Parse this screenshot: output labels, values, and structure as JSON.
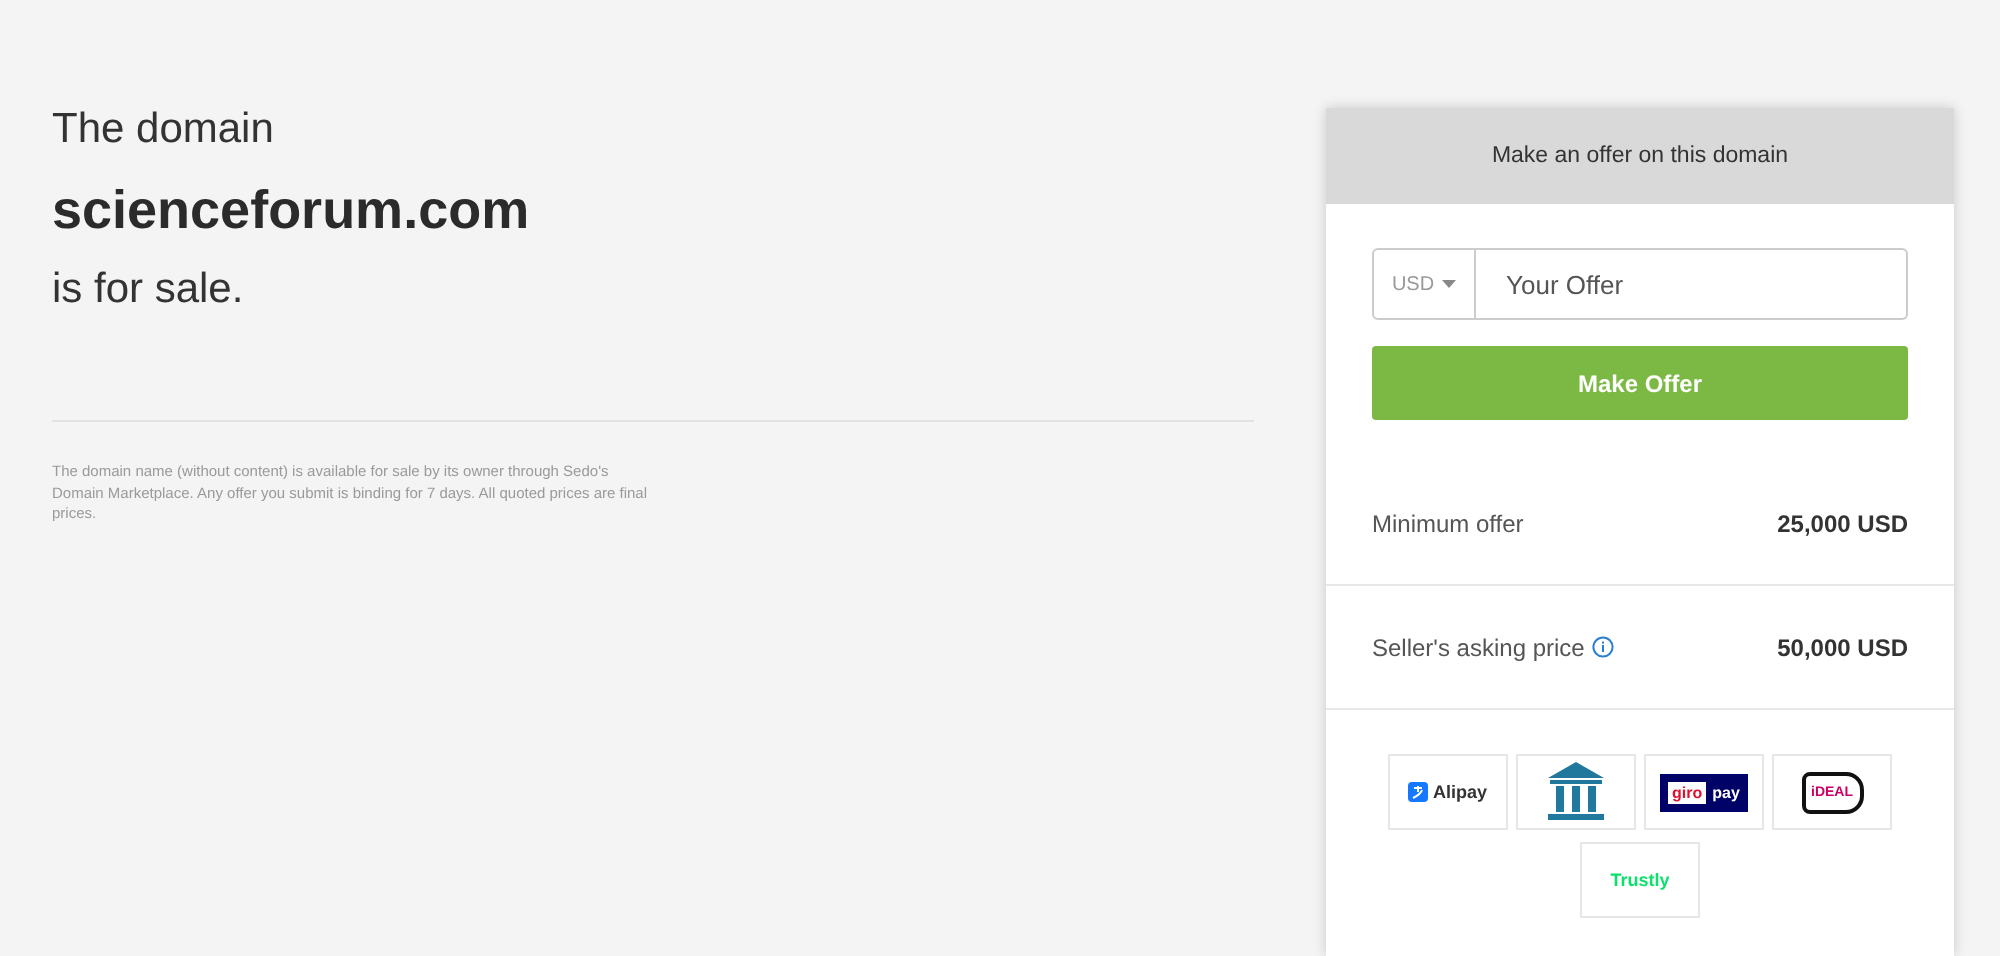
{
  "intro": {
    "line_1": "The domain",
    "domain": "scienceforum.com",
    "line_2": "is for sale."
  },
  "disclaimer": "The domain name (without content) is available for sale by its owner through Sedo's Domain Marketplace. Any offer you submit is binding for 7 days. All quoted prices are final prices.",
  "offer_card": {
    "title": "Make an offer on this domain",
    "currency": "USD",
    "placeholder": "Your Offer",
    "button": "Make Offer",
    "prices": [
      {
        "label": "Minimum offer",
        "value": "25,000 USD",
        "info": false
      },
      {
        "label": "Seller's asking price",
        "value": "50,000 USD",
        "info": true
      }
    ],
    "payment_methods": [
      {
        "kind": "alipay",
        "label": "Alipay"
      },
      {
        "kind": "bank"
      },
      {
        "kind": "giropay",
        "label_1": "giro",
        "label_2": "pay"
      },
      {
        "kind": "ideal",
        "label": "iDEAL"
      },
      {
        "kind": "trustly",
        "label": "Trustly"
      }
    ]
  }
}
